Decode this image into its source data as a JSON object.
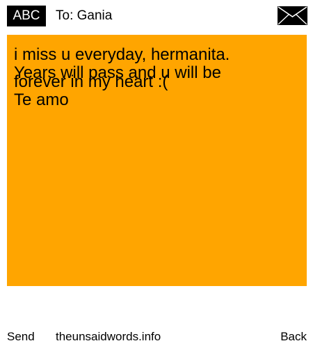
{
  "header": {
    "badge_label": "ABC",
    "to_text": "To: Gania",
    "envelope_icon": "envelope-icon"
  },
  "note": {
    "background_color": "#ffa500",
    "lines": [
      "i miss u everyday, hermanita.",
      "Years will pass and u will be",
      "forever in my heart :(",
      "Te amo"
    ]
  },
  "footer": {
    "send_label": "Send",
    "site_label": "theunsaidwords.info",
    "back_label": "Back"
  }
}
